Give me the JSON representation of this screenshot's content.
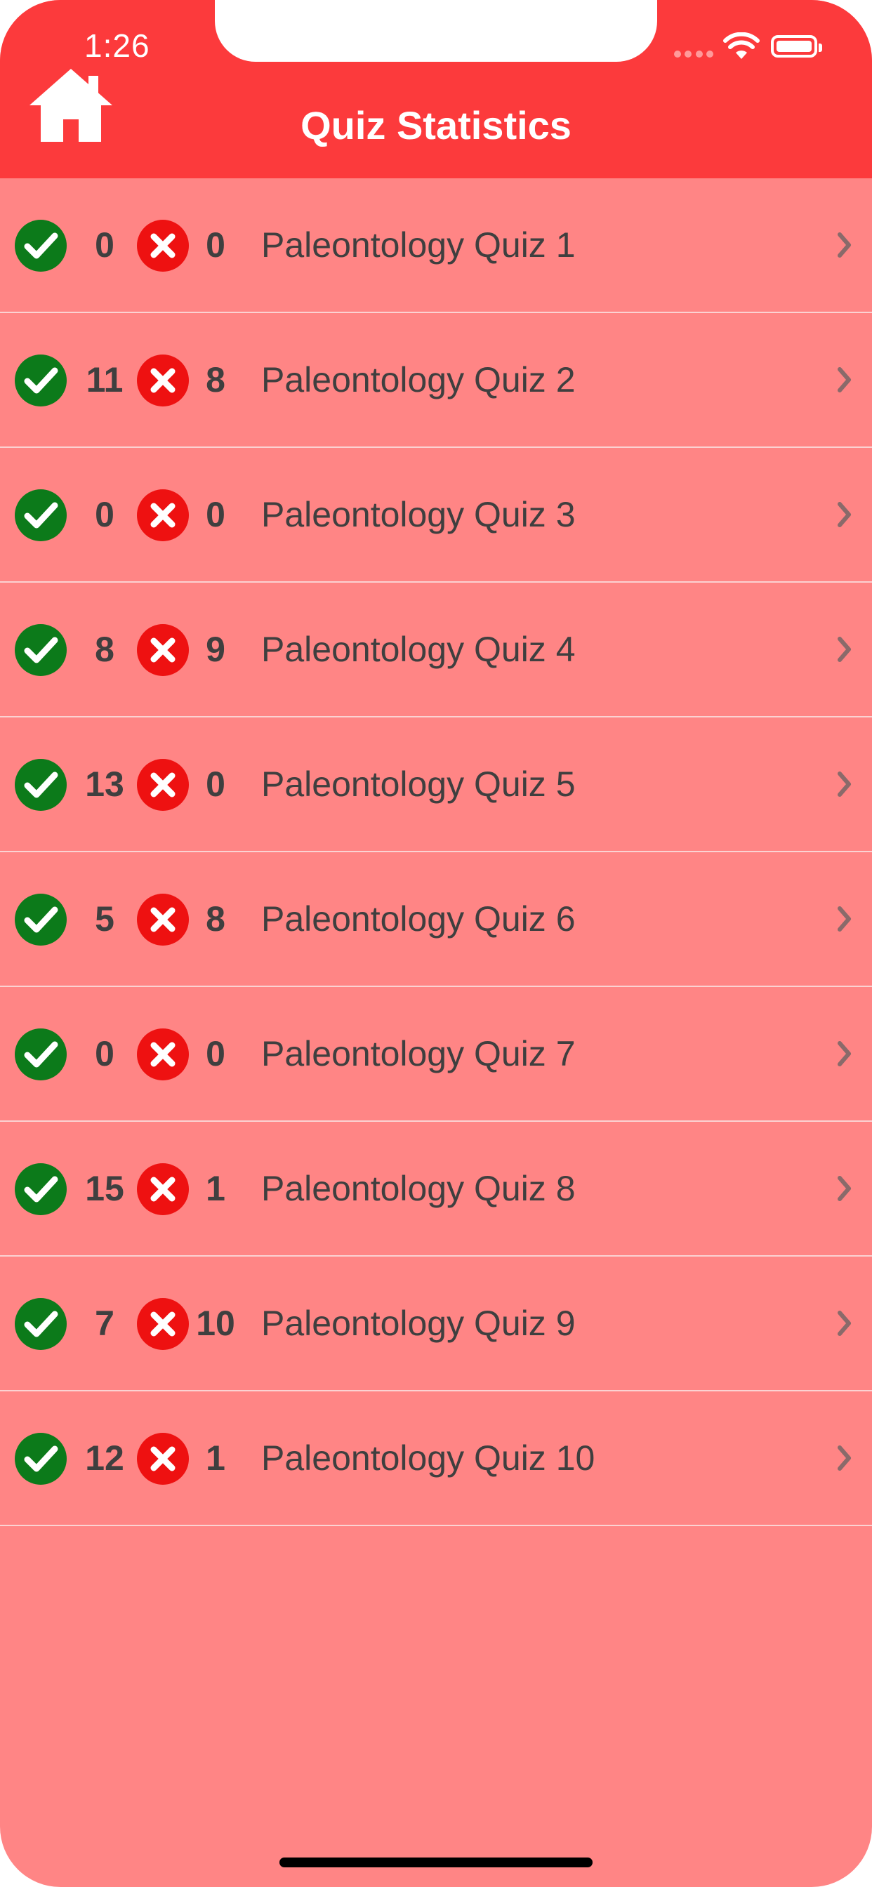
{
  "status_bar": {
    "time": "1:26"
  },
  "header": {
    "title": "Quiz Statistics",
    "home_icon": "home-icon",
    "background_color": "#fc3a3c"
  },
  "colors": {
    "list_background": "#ff8585",
    "correct_icon": "#0c7a1a",
    "wrong_icon": "#ee1111",
    "text": "#3f3f3f"
  },
  "quizzes": [
    {
      "correct": "0",
      "wrong": "0",
      "name": "Paleontology Quiz 1"
    },
    {
      "correct": "11",
      "wrong": "8",
      "name": "Paleontology Quiz 2"
    },
    {
      "correct": "0",
      "wrong": "0",
      "name": "Paleontology Quiz 3"
    },
    {
      "correct": "8",
      "wrong": "9",
      "name": "Paleontology Quiz 4"
    },
    {
      "correct": "13",
      "wrong": "0",
      "name": "Paleontology Quiz 5"
    },
    {
      "correct": "5",
      "wrong": "8",
      "name": "Paleontology Quiz 6"
    },
    {
      "correct": "0",
      "wrong": "0",
      "name": "Paleontology Quiz 7"
    },
    {
      "correct": "15",
      "wrong": "1",
      "name": "Paleontology Quiz 8"
    },
    {
      "correct": "7",
      "wrong": "10",
      "name": "Paleontology Quiz 9"
    },
    {
      "correct": "12",
      "wrong": "1",
      "name": "Paleontology Quiz 10"
    }
  ]
}
